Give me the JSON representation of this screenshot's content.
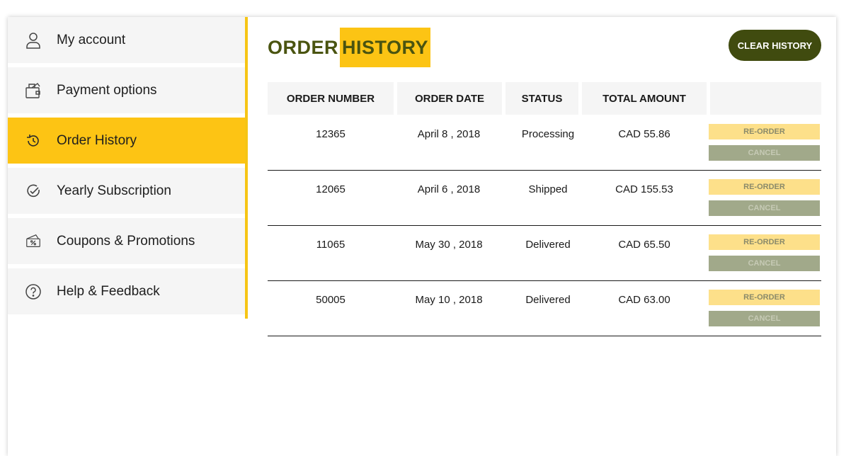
{
  "sidebar": {
    "items": [
      {
        "label": "My account",
        "icon": "user-icon"
      },
      {
        "label": "Payment options",
        "icon": "wallet-icon"
      },
      {
        "label": "Order History",
        "icon": "history-icon",
        "active": true
      },
      {
        "label": "Yearly Subscription",
        "icon": "check-circle-icon"
      },
      {
        "label": "Coupons & Promotions",
        "icon": "coupon-icon"
      },
      {
        "label": "Help & Feedback",
        "icon": "help-icon"
      }
    ]
  },
  "header": {
    "title_part1": "ORDER",
    "title_part2": "HISTORY",
    "clear_label": "CLEAR HISTORY"
  },
  "table": {
    "columns": [
      "ORDER NUMBER",
      "ORDER DATE",
      "STATUS",
      "TOTAL AMOUNT"
    ],
    "rows": [
      {
        "order_number": "12365",
        "order_date": "April 8 , 2018",
        "status": "Processing",
        "total": "CAD 55.86",
        "reorder_label": "RE-ORDER",
        "cancel_label": "CANCEL"
      },
      {
        "order_number": "12065",
        "order_date": "April 6 , 2018",
        "status": "Shipped",
        "total": "CAD 155.53",
        "reorder_label": "RE-ORDER",
        "cancel_label": "CANCEL"
      },
      {
        "order_number": "11065",
        "order_date": "May 30 , 2018",
        "status": "Delivered",
        "total": "CAD 65.50",
        "reorder_label": "RE-ORDER",
        "cancel_label": "CANCEL"
      },
      {
        "order_number": "50005",
        "order_date": "May 10 , 2018",
        "status": "Delivered",
        "total": "CAD 63.00",
        "reorder_label": "RE-ORDER",
        "cancel_label": "CANCEL"
      }
    ]
  },
  "colors": {
    "accent_yellow": "#fdc414",
    "dark_olive": "#404b0f",
    "reorder_bg": "#fde08a",
    "cancel_bg": "#a1a98a"
  }
}
